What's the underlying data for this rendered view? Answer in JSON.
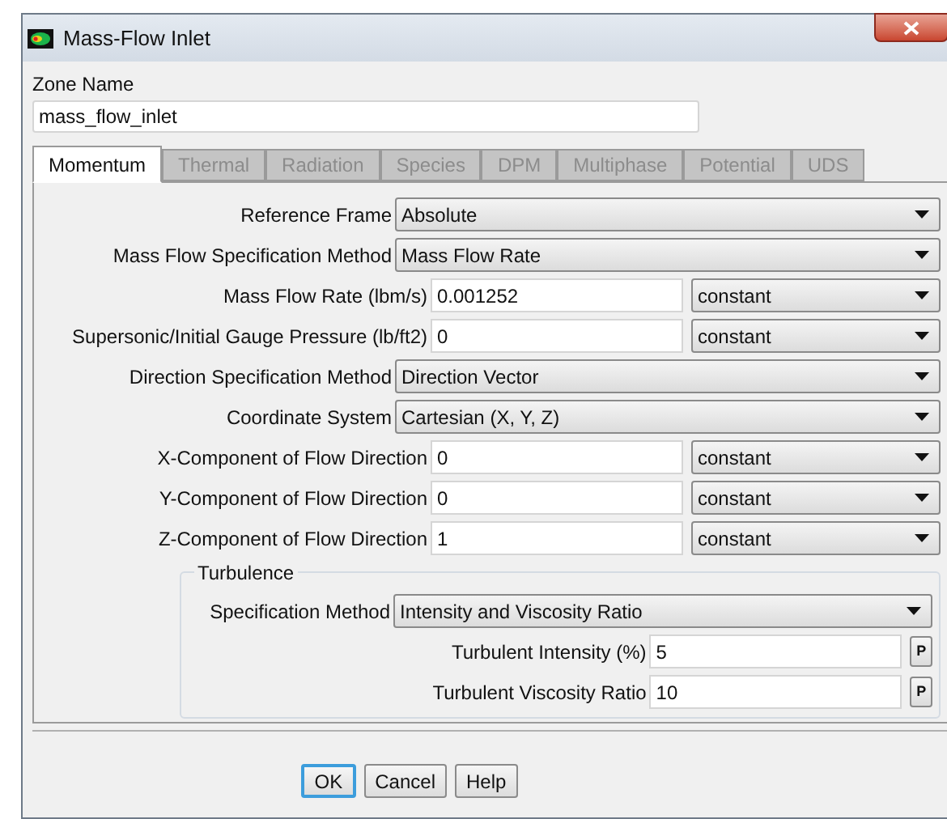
{
  "window": {
    "title": "Mass-Flow Inlet"
  },
  "zone_name": {
    "label": "Zone Name",
    "value": "mass_flow_inlet"
  },
  "tabs": [
    {
      "label": "Momentum",
      "selected": true,
      "disabled": false
    },
    {
      "label": "Thermal",
      "selected": false,
      "disabled": true
    },
    {
      "label": "Radiation",
      "selected": false,
      "disabled": true
    },
    {
      "label": "Species",
      "selected": false,
      "disabled": true
    },
    {
      "label": "DPM",
      "selected": false,
      "disabled": true
    },
    {
      "label": "Multiphase",
      "selected": false,
      "disabled": true
    },
    {
      "label": "Potential",
      "selected": false,
      "disabled": true
    },
    {
      "label": "UDS",
      "selected": false,
      "disabled": true
    }
  ],
  "fields": [
    {
      "kind": "dropdown",
      "label": "Reference Frame",
      "value": "Absolute"
    },
    {
      "kind": "dropdown",
      "label": "Mass Flow Specification Method",
      "value": "Mass Flow Rate"
    },
    {
      "kind": "input",
      "label": "Mass Flow Rate (lbm/s)",
      "value": "0.001252",
      "profile": "constant"
    },
    {
      "kind": "input",
      "label": "Supersonic/Initial Gauge Pressure (lb/ft2)",
      "value": "0",
      "profile": "constant"
    },
    {
      "kind": "dropdown",
      "label": "Direction Specification Method",
      "value": "Direction Vector"
    },
    {
      "kind": "dropdown",
      "label": "Coordinate System",
      "value": "Cartesian (X, Y, Z)"
    },
    {
      "kind": "input",
      "label": "X-Component of Flow Direction",
      "value": "0",
      "profile": "constant"
    },
    {
      "kind": "input",
      "label": "Y-Component of Flow Direction",
      "value": "0",
      "profile": "constant"
    },
    {
      "kind": "input",
      "label": "Z-Component of Flow Direction",
      "value": "1",
      "profile": "constant"
    }
  ],
  "turbulence": {
    "title": "Turbulence",
    "fields": [
      {
        "kind": "dropdown",
        "label": "Specification Method",
        "value": "Intensity and Viscosity Ratio"
      },
      {
        "kind": "param",
        "label": "Turbulent Intensity (%)",
        "value": "5",
        "button": "P"
      },
      {
        "kind": "param",
        "label": "Turbulent Viscosity Ratio",
        "value": "10",
        "button": "P"
      }
    ]
  },
  "buttons": [
    {
      "label": "OK",
      "default": true
    },
    {
      "label": "Cancel",
      "default": false
    },
    {
      "label": "Help",
      "default": false
    }
  ]
}
